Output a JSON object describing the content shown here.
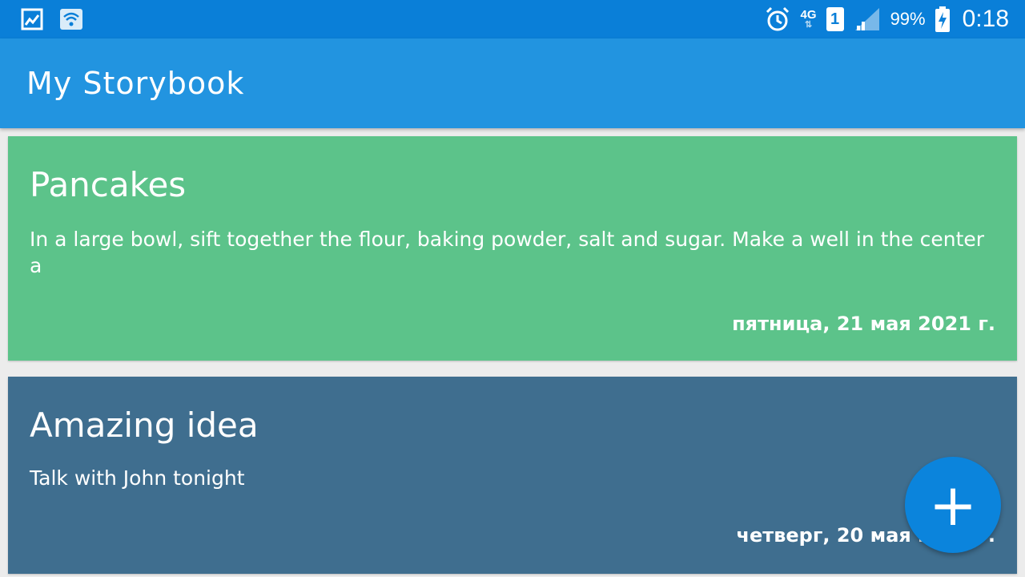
{
  "status_bar": {
    "left_icons": [
      "image-icon",
      "wifi-icon"
    ],
    "right_icons": [
      "alarm-icon",
      "signal-icon",
      "battery-charging-icon"
    ],
    "network": "4G",
    "network_arrows": "⇅",
    "sim": "1",
    "battery": "99%",
    "time": "0:18"
  },
  "app_bar": {
    "title": "My Storybook"
  },
  "notes": [
    {
      "title": "Pancakes",
      "body": "In a large bowl, sift together the flour, baking powder, salt and sugar. Make a well in the center a",
      "date": "пятница, 21 мая 2021 г.",
      "color": "#5cc38a"
    },
    {
      "title": "Amazing idea",
      "body": "Talk with John tonight",
      "date": "четверг, 20 мая 2021 г.",
      "color": "#3f6e8f"
    }
  ],
  "fab": {
    "icon": "plus-icon",
    "glyph": "+"
  },
  "colors": {
    "status_bar": "#0a7fd8",
    "app_bar": "#2294e0",
    "fab": "#0b84dc"
  }
}
